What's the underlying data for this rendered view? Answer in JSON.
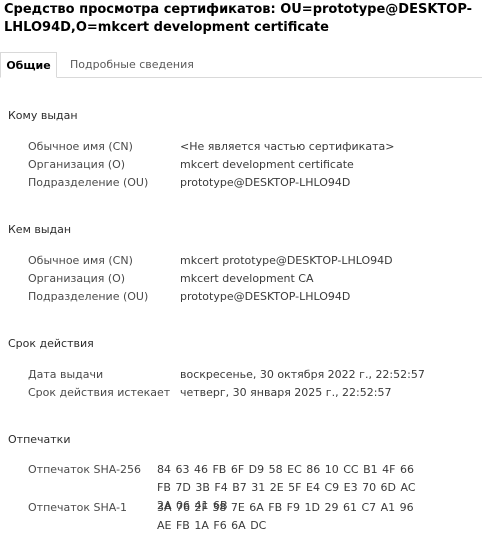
{
  "window": {
    "title": "Средство просмотра сертификатов: OU=prototype@DESKTOP-LHLO94D,O=mkcert development certificate"
  },
  "tabs": [
    {
      "label": "Общие"
    },
    {
      "label": "Подробные сведения"
    }
  ],
  "issued_to": {
    "heading": "Кому выдан",
    "rows": [
      {
        "label": "Обычное имя (CN)",
        "value": "<Не является частью сертификата>"
      },
      {
        "label": "Организация (O)",
        "value": "mkcert development certificate"
      },
      {
        "label": "Подразделение (OU)",
        "value": "prototype@DESKTOP-LHLO94D"
      }
    ]
  },
  "issued_by": {
    "heading": "Кем выдан",
    "rows": [
      {
        "label": "Обычное имя (CN)",
        "value": "mkcert prototype@DESKTOP-LHLO94D"
      },
      {
        "label": "Организация (O)",
        "value": "mkcert development CA"
      },
      {
        "label": "Подразделение (OU)",
        "value": "prototype@DESKTOP-LHLO94D"
      }
    ]
  },
  "validity": {
    "heading": "Срок действия",
    "rows": [
      {
        "label": "Дата выдачи",
        "value": "воскресенье, 30 октября 2022 г., 22:52:57"
      },
      {
        "label": "Срок действия истекает",
        "value": "четверг, 30 января 2025 г., 22:52:57"
      }
    ]
  },
  "fingerprints": {
    "heading": "Отпечатки",
    "rows": [
      {
        "label": "Отпечаток SHA-256",
        "value": "84 63 46 FB 6F D9 58 EC 86 10 CC B1 4F 66 FB 7D 3B F4 B7 31 2E 5F E4 C9 E3 70 6D AC 2A 06 41 6B"
      },
      {
        "label": "Отпечаток SHA-1",
        "value": "3A 76 2F 38 7E 6A FB F9 1D 29 61 C7 A1 96 AE FB 1A F6 6A DC"
      }
    ]
  }
}
